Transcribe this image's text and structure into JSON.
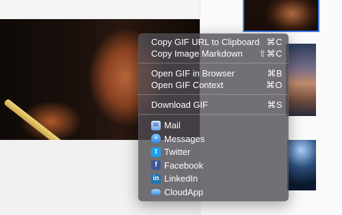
{
  "context_menu": {
    "groups": [
      [
        {
          "label": "Copy GIF URL to Clipboard",
          "shortcut": "⌘C"
        },
        {
          "label": "Copy Image Markdown",
          "shortcut": "⇧⌘C"
        }
      ],
      [
        {
          "label": "Open GIF in Browser",
          "shortcut": "⌘B"
        },
        {
          "label": "Open GIF Context",
          "shortcut": "⌘O"
        }
      ],
      [
        {
          "label": "Download GIF",
          "shortcut": "⌘S"
        }
      ]
    ],
    "share_items": [
      {
        "label": "Mail",
        "icon": "mail-icon"
      },
      {
        "label": "Messages",
        "icon": "messages-icon"
      },
      {
        "label": "Twitter",
        "icon": "twitter-icon"
      },
      {
        "label": "Facebook",
        "icon": "facebook-icon"
      },
      {
        "label": "LinkedIn",
        "icon": "linkedin-icon"
      },
      {
        "label": "CloudApp",
        "icon": "cloudapp-icon"
      }
    ]
  },
  "icon_glyphs": {
    "twitter": "t",
    "facebook": "f",
    "linkedin": "in"
  },
  "colors": {
    "selection_border": "#3d7cf0",
    "menu_background": "rgba(80,76,84,0.80)"
  }
}
